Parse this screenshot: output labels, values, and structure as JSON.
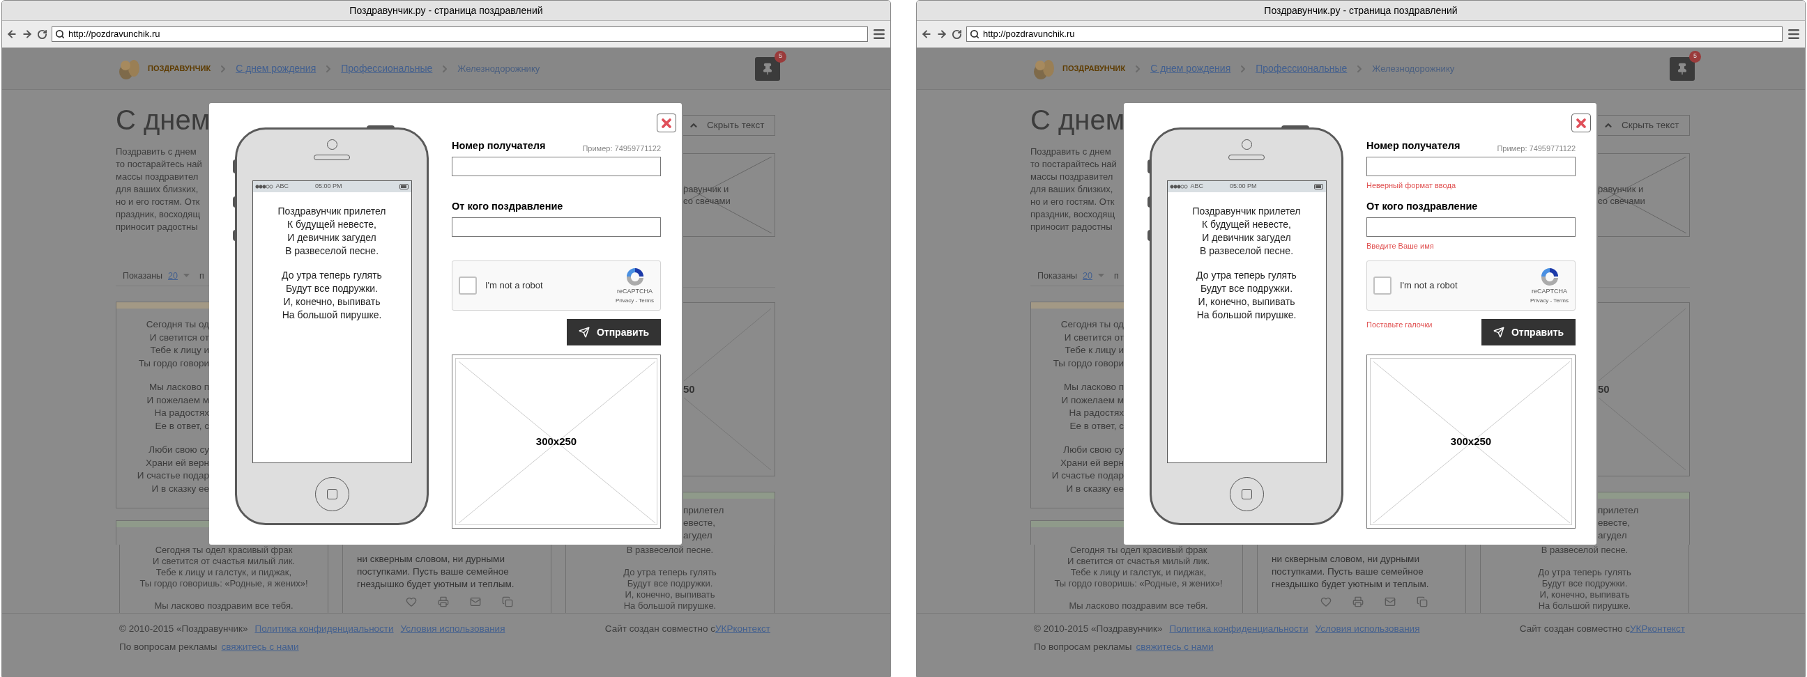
{
  "windows": [
    {
      "title": "Поздравунчик.ру - страница поздравлений",
      "url": "http://pozdravunchik.ru",
      "site_header": {
        "logo": "ПОЗДРАВУНЧИК",
        "breadcrumbs": [
          {
            "label": "С днем рождения",
            "kind": "link"
          },
          {
            "label": "Профессиональные",
            "kind": "link"
          },
          {
            "label": "Железнодорожнику",
            "kind": "current"
          }
        ],
        "badge": "5"
      },
      "left_strip": {
        "heading": "С днем",
        "intro": [
          "Поздравить с днем",
          "то постарайтесь най",
          "массы поздравител",
          "для ваших близких,",
          "но и его гостям. Отк",
          "праздник, восходящ",
          "приносит радостны"
        ],
        "pager": {
          "label": "Показаны",
          "value": "20",
          "rest": "п"
        },
        "card": [
          [
            "Сегодня ты од",
            "И светится от",
            "Тебе к лицу и",
            "Ты гордо говори"
          ],
          [
            "Мы ласково п",
            "И пожелаем м",
            "На радостях",
            "Ее в ответ, с"
          ],
          [
            "Люби свою су",
            "Храни ей верн",
            "И счастье подар",
            "И в сказку ее"
          ]
        ]
      },
      "right_strip": {
        "hide_button": "Скрыть текст",
        "image_caption": [
          "равунчик и",
          "со свечами"
        ],
        "ad_fragment": "50",
        "card": [
          "прилетел",
          "евесте,",
          "агудел"
        ]
      },
      "bottom_cards": [
        {
          "kind": "poem",
          "stanzas": [
            [
              "Сегодня ты одел красивый фрак",
              "И светится от счастья милый лик.",
              "Тебе к лицу и галстук, и пиджак,",
              "Ты гордо говоришь: «Родные, я жених»!"
            ],
            [
              "Мы ласково поздравим все тебя."
            ]
          ]
        },
        {
          "kind": "prose",
          "text": "ни скверным словом, ни дурными поступками. Пусть ваше семейное гнездышко будет уютным и теплым."
        },
        {
          "kind": "poem",
          "stanzas": [
            [
              "В развеселой песне."
            ],
            [
              "До утра теперь гулять",
              "Будут все подружки.",
              "И, конечно, выпивать",
              "На большой пирушке."
            ]
          ]
        }
      ],
      "footer": {
        "copyright": "© 2010-2015 «Поздравунчик»",
        "links": [
          "Политика конфиденциальности",
          "Условия использования"
        ],
        "credit": "Сайт создан совместно с",
        "credit_link": "УКРконтекст",
        "ads_label": "По вопросам рекламы",
        "ads_link": "свяжитесь с нами"
      },
      "modal": {
        "phone": {
          "carrier": "ABC",
          "time": "05:00 PM",
          "stanzas": [
            [
              "Поздравунчик прилетел",
              "К будущей невесте,",
              "И девичник загудел",
              "В развеселой песне."
            ],
            [
              "До утра теперь гулять",
              "Будут все подружки.",
              "И, конечно, выпивать",
              "На большой пирушке."
            ]
          ]
        },
        "fields": [
          {
            "label": "Номер получателя",
            "hint": "Пример: 74959771122"
          },
          {
            "label": "От кого поздравление"
          }
        ],
        "captcha": {
          "label": "I'm not a robot",
          "checked": false,
          "brand": "reCAPTCHA",
          "links": "Privacy - Terms"
        },
        "submit": "Отправить",
        "ad": "300x250"
      }
    },
    {
      "title": "Поздравунчик.ру - страница поздравлений",
      "url": "http://pozdravunchik.ru",
      "site_header": {
        "logo": "ПОЗДРАВУНЧИК",
        "breadcrumbs": [
          {
            "label": "С днем рождения",
            "kind": "link"
          },
          {
            "label": "Профессиональные",
            "kind": "link"
          },
          {
            "label": "Железнодорожнику",
            "kind": "current"
          }
        ],
        "badge": "5"
      },
      "left_strip": {
        "heading": "С днем",
        "intro": [
          "Поздравить с днем",
          "то постарайтесь най",
          "массы поздравител",
          "для ваших близких,",
          "но и его гостям. Отк",
          "праздник, восходящ",
          "приносит радостны"
        ],
        "pager": {
          "label": "Показаны",
          "value": "20",
          "rest": "п"
        },
        "card": [
          [
            "Сегодня ты од",
            "И светится от",
            "Тебе к лицу и",
            "Ты гордо говори"
          ],
          [
            "Мы ласково п",
            "И пожелаем м",
            "На радостях",
            "Ее в ответ, с"
          ],
          [
            "Люби свою су",
            "Храни ей верн",
            "И счастье подар",
            "И в сказку ее"
          ]
        ]
      },
      "right_strip": {
        "hide_button": "Скрыть текст",
        "image_caption": [
          "равунчик и",
          "со свечами"
        ],
        "ad_fragment": "50",
        "card": [
          "прилетел",
          "евесте,",
          "агудел"
        ]
      },
      "bottom_cards": [
        {
          "kind": "poem",
          "stanzas": [
            [
              "Сегодня ты одел красивый фрак",
              "И светится от счастья милый лик.",
              "Тебе к лицу и галстук, и пиджак,",
              "Ты гордо говоришь: «Родные, я жених»!"
            ],
            [
              "Мы ласково поздравим все тебя."
            ]
          ]
        },
        {
          "kind": "prose",
          "text": "ни скверным словом, ни дурными поступками. Пусть ваше семейное гнездышко будет уютным и теплым."
        },
        {
          "kind": "poem",
          "stanzas": [
            [
              "В развеселой песне."
            ],
            [
              "До утра теперь гулять",
              "Будут все подружки.",
              "И, конечно, выпивать",
              "На большой пирушке."
            ]
          ]
        }
      ],
      "footer": {
        "copyright": "© 2010-2015 «Поздравунчик»",
        "links": [
          "Политика конфиденциальности",
          "Условия использования"
        ],
        "credit": "Сайт создан совместно с",
        "credit_link": "УКРконтекст",
        "ads_label": "По вопросам рекламы",
        "ads_link": "свяжитесь с нами"
      },
      "modal": {
        "phone": {
          "carrier": "ABC",
          "time": "05:00 PM",
          "stanzas": [
            [
              "Поздравунчик прилетел",
              "К будущей невесте,",
              "И девичник загудел",
              "В развеселой песне."
            ],
            [
              "До утра теперь гулять",
              "Будут все подружки.",
              "И, конечно, выпивать",
              "На большой пирушке."
            ]
          ]
        },
        "fields": [
          {
            "label": "Номер получателя",
            "hint": "Пример: 74959771122",
            "error": "Неверный формат ввода"
          },
          {
            "label": "От кого поздравление",
            "error": "Введите Ваше имя"
          }
        ],
        "captcha": {
          "label": "I'm not a robot",
          "checked": false,
          "brand": "reCAPTCHA",
          "links": "Privacy - Terms",
          "error": "Поставьте галочки"
        },
        "submit": "Отправить",
        "ad": "300x250"
      }
    }
  ]
}
